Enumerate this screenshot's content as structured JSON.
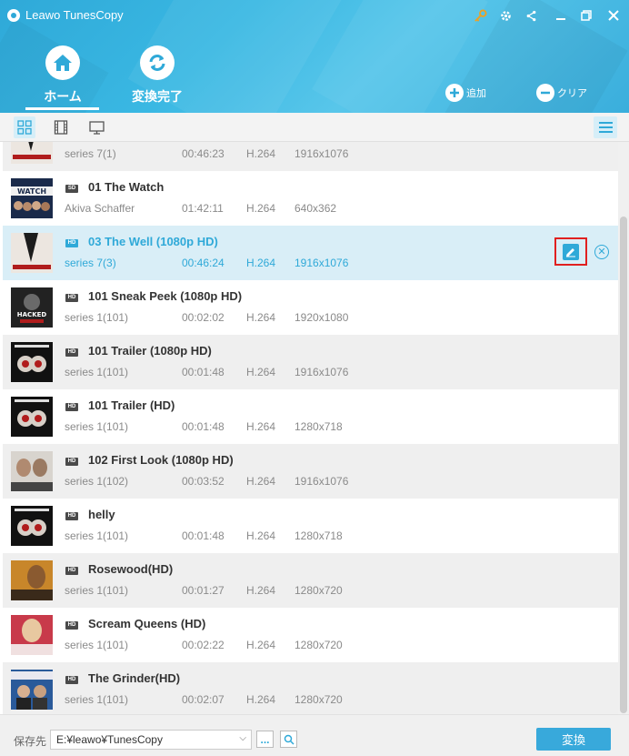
{
  "app": {
    "title": "Leawo TunesCopy"
  },
  "window_controls": [
    {
      "name": "key-icon"
    },
    {
      "name": "gear-icon"
    },
    {
      "name": "share-icon"
    },
    {
      "name": "minimize-icon"
    },
    {
      "name": "restore-icon"
    },
    {
      "name": "close-icon"
    }
  ],
  "nav": {
    "home": {
      "label": "ホーム",
      "icon": "home-icon",
      "active": true
    },
    "converted": {
      "label": "変換完了",
      "icon": "refresh-icon",
      "active": false
    }
  },
  "actions": {
    "add": {
      "label": "追加",
      "icon": "plus-circle-icon"
    },
    "clear": {
      "label": "クリア",
      "icon": "minus-circle-icon"
    }
  },
  "toolbar": {
    "views": [
      "grid-view-icon",
      "film-view-icon",
      "monitor-view-icon"
    ],
    "menu_icon": "hamburger-menu-icon"
  },
  "items": [
    {
      "quality": "HD",
      "title": "",
      "author": "series 7(1)",
      "duration": "00:46:23",
      "codec": "H.264",
      "resolution": "1916x1076",
      "thumb": "walking-dead"
    },
    {
      "quality": "SD",
      "title": "01 The Watch",
      "author": "Akiva Schaffer",
      "duration": "01:42:11",
      "codec": "H.264",
      "resolution": "640x362",
      "thumb": "watch"
    },
    {
      "quality": "HD",
      "title": "03 The Well (1080p HD)",
      "author": "series 7(3)",
      "duration": "00:46:24",
      "codec": "H.264",
      "resolution": "1916x1076",
      "thumb": "walking-dead",
      "selected": true
    },
    {
      "quality": "HD",
      "title": "101 Sneak Peek (1080p HD)",
      "author": "series 1(101)",
      "duration": "00:02:02",
      "codec": "H.264",
      "resolution": "1920x1080",
      "thumb": "hacked"
    },
    {
      "quality": "HD",
      "title": "101 Trailer (1080p HD)",
      "author": "series 1(101)",
      "duration": "00:01:48",
      "codec": "H.264",
      "resolution": "1916x1076",
      "thumb": "containment"
    },
    {
      "quality": "HD",
      "title": "101 Trailer (HD)",
      "author": "series 1(101)",
      "duration": "00:01:48",
      "codec": "H.264",
      "resolution": "1280x718",
      "thumb": "containment"
    },
    {
      "quality": "HD",
      "title": "102 First Look (1080p HD)",
      "author": "series 1(102)",
      "duration": "00:03:52",
      "codec": "H.264",
      "resolution": "1916x1076",
      "thumb": "unforgettable"
    },
    {
      "quality": "HD",
      "title": "helly",
      "author": "series 1(101)",
      "duration": "00:01:48",
      "codec": "H.264",
      "resolution": "1280x718",
      "thumb": "containment"
    },
    {
      "quality": "HD",
      "title": "Rosewood(HD)",
      "author": "series 1(101)",
      "duration": "00:01:27",
      "codec": "H.264",
      "resolution": "1280x720",
      "thumb": "rosewood"
    },
    {
      "quality": "HD",
      "title": "Scream Queens (HD)",
      "author": "series 1(101)",
      "duration": "00:02:22",
      "codec": "H.264",
      "resolution": "1280x720",
      "thumb": "scream"
    },
    {
      "quality": "HD",
      "title": "The Grinder(HD)",
      "author": "series 1(101)",
      "duration": "00:02:07",
      "codec": "H.264",
      "resolution": "1280x720",
      "thumb": "grinder"
    }
  ],
  "footer": {
    "save_label": "保存先",
    "path": "E:¥leawo¥TunesCopy",
    "browse_label": "...",
    "convert_label": "変換"
  },
  "colors": {
    "accent": "#2fa9d8",
    "highlight_border": "#e02020",
    "selected_row": "#d9eef7"
  }
}
